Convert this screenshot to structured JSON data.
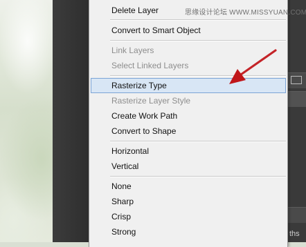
{
  "watermark": "思缘设计论坛  WWW.MISSYUAN.COM",
  "menu": {
    "items": [
      {
        "label": "Delete Layer",
        "disabled": false
      },
      {
        "label": "Convert to Smart Object",
        "disabled": false
      },
      {
        "label": "Link Layers",
        "disabled": true
      },
      {
        "label": "Select Linked Layers",
        "disabled": true
      },
      {
        "label": "Rasterize Type",
        "disabled": false,
        "highlighted": true
      },
      {
        "label": "Rasterize Layer Style",
        "disabled": true
      },
      {
        "label": "Create Work Path",
        "disabled": false
      },
      {
        "label": "Convert to Shape",
        "disabled": false
      },
      {
        "label": "Horizontal",
        "disabled": false
      },
      {
        "label": "Vertical",
        "disabled": false
      },
      {
        "label": "None",
        "disabled": false
      },
      {
        "label": "Sharp",
        "disabled": false
      },
      {
        "label": "Crisp",
        "disabled": false
      },
      {
        "label": "Strong",
        "disabled": false
      }
    ]
  },
  "right_panel": {
    "visible_text": "ths"
  },
  "colors": {
    "highlight": "#d8e6f5",
    "highlight_border": "#7ba4d6",
    "arrow": "#c0161a"
  }
}
